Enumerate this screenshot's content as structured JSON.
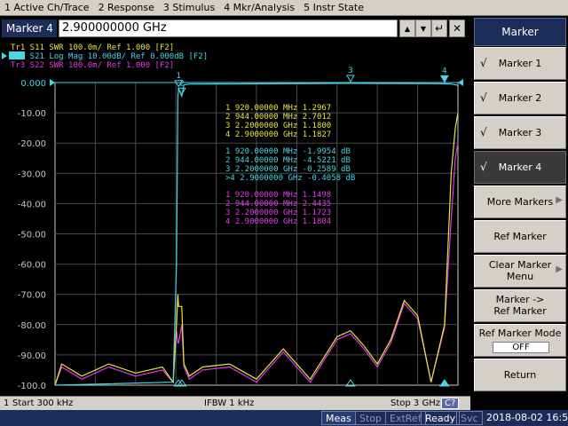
{
  "menu": [
    "1 Active Ch/Trace",
    "2 Response",
    "3 Stimulus",
    "4 Mkr/Analysis",
    "5 Instr State"
  ],
  "entry": {
    "title": "Marker 4",
    "value": "2.900000000 GHz",
    "btn_up": "▲",
    "btn_down": "▼",
    "btn_enter": "↵",
    "btn_close": "✕"
  },
  "colors": {
    "tr1": "#e6e63c",
    "tr2": "#46d6e6",
    "tr3": "#e23ce6",
    "grid": "#4a4a4a",
    "frame": "#c8c8c8",
    "label": "#c8c8c8"
  },
  "traces": [
    {
      "label": "Tr1  S11  SWR 100.0m/ Ref 1.000  [F2]",
      "color": "#e6e63c"
    },
    {
      "label": "Tr2  S21  Log Mag 10.00dB/ Ref 0.000dB  [F2]",
      "color": "#46d6e6",
      "active": true
    },
    {
      "label": "Tr3  S22  SWR 100.0m/ Ref 1.000  [F2]",
      "color": "#e23ce6"
    }
  ],
  "marker_table": {
    "tr1": [
      "1   920.00000  MHz   1.2967",
      "2   944.00000  MHz   2.7012",
      "3   2.2000000  GHz   1.1800",
      "4   2.9000000  GHz   1.1827"
    ],
    "tr2": [
      "1   920.00000  MHz  -1.9954  dB",
      "2   944.00000  MHz  -4.5221  dB",
      "3   2.2000000  GHz  -0.2589  dB",
      ">4  2.9000000  GHz  -0.4058  dB"
    ],
    "tr3": [
      "1   920.00000  MHz   1.1498",
      "2   944.00000  MHz   2.4435",
      "3   2.2000000  GHz   1.1723",
      "4   2.9000000  GHz   1.1804"
    ]
  },
  "chart_data": {
    "type": "line",
    "xlabel": "",
    "ylabel": "",
    "xlim_mhz": [
      0.3,
      3000
    ],
    "ylim": [
      -100,
      0
    ],
    "y_tick_labels": [
      "0.000",
      "-10.00",
      "-20.00",
      "-30.00",
      "-40.00",
      "-50.00",
      "-60.00",
      "-70.00",
      "-80.00",
      "-90.00",
      "-100.0"
    ],
    "y_ticks": [
      0,
      -10,
      -20,
      -30,
      -40,
      -50,
      -60,
      -70,
      -80,
      -90,
      -100
    ],
    "grid": true,
    "series": [
      {
        "name": "S21",
        "color": "#46d6e6",
        "x_mhz": [
          0.3,
          880,
          905,
          915,
          920,
          944,
          960,
          1000,
          1500,
          2000,
          2200,
          2500,
          2800,
          2900,
          2950,
          2980,
          3000
        ],
        "y": [
          -100,
          -99,
          -60,
          -5,
          -1.9954,
          -4.5221,
          -0.8,
          -0.5,
          -0.4,
          -0.3,
          -0.2589,
          -0.3,
          -0.35,
          -0.4058,
          -0.5,
          -0.7,
          -1
        ]
      },
      {
        "name": "S11",
        "color": "#e6e63c",
        "x_mhz": [
          0.3,
          50,
          200,
          400,
          600,
          800,
          880,
          905,
          915,
          920,
          944,
          960,
          1000,
          1100,
          1300,
          1500,
          1700,
          1900,
          2100,
          2200,
          2300,
          2400,
          2500,
          2600,
          2700,
          2800,
          2900,
          2950,
          2980,
          3000
        ],
        "y": [
          -100,
          -93,
          -97,
          -93,
          -96,
          -94,
          -99,
          -80,
          -70,
          -74,
          -74,
          -93,
          -97,
          -94,
          -93,
          -98,
          -88,
          -98,
          -84,
          -82,
          -87,
          -93,
          -85,
          -72,
          -77,
          -99,
          -80,
          -30,
          -15,
          -10
        ]
      },
      {
        "name": "S22",
        "color": "#e23ce6",
        "x_mhz": [
          0.3,
          50,
          200,
          400,
          600,
          800,
          880,
          905,
          915,
          920,
          944,
          960,
          1000,
          1100,
          1300,
          1500,
          1700,
          1900,
          2100,
          2200,
          2300,
          2400,
          2500,
          2600,
          2700,
          2800,
          2900,
          2950,
          2980,
          3000
        ],
        "y": [
          -100,
          -94,
          -98,
          -94,
          -97,
          -95,
          -99,
          -82,
          -86,
          -86,
          -80,
          -94,
          -98,
          -95,
          -94,
          -99,
          -89,
          -99,
          -85,
          -83,
          -88,
          -94,
          -86,
          -73,
          -78,
          -99,
          -81,
          -45,
          -25,
          -20
        ]
      }
    ],
    "markers": [
      {
        "id": "1",
        "x_mhz": 920,
        "y": -1.9954
      },
      {
        "id": "2",
        "x_mhz": 944,
        "y": -4.5221
      },
      {
        "id": "3",
        "x_mhz": 2200,
        "y": -0.2589
      },
      {
        "id": "4",
        "x_mhz": 2900,
        "y": -0.4058,
        "active": true
      }
    ]
  },
  "status": {
    "start": "Start 300 kHz",
    "ifbw": "IFBW 1 kHz",
    "stop": "Stop 3 GHz",
    "cal": "C?",
    "channel": "1"
  },
  "sysbar": {
    "meas": "Meas",
    "stop": "Stop",
    "extref": "ExtRef",
    "ready": "Ready",
    "svc": "Svc",
    "datetime": "2018-08-02 16:58"
  },
  "softkeys": {
    "title": "Marker",
    "marker1": "Marker 1",
    "marker2": "Marker 2",
    "marker3": "Marker 3",
    "marker4": "Marker 4",
    "more_markers": "More Markers",
    "ref_marker": "Ref Marker",
    "clear_marker_1": "Clear Marker",
    "clear_marker_2": "Menu",
    "marker_ref_1": "Marker ->",
    "marker_ref_2": "Ref Marker",
    "ref_mode": "Ref Marker Mode",
    "ref_mode_value": "OFF",
    "return": "Return",
    "check": "√",
    "arrow": "▶"
  }
}
